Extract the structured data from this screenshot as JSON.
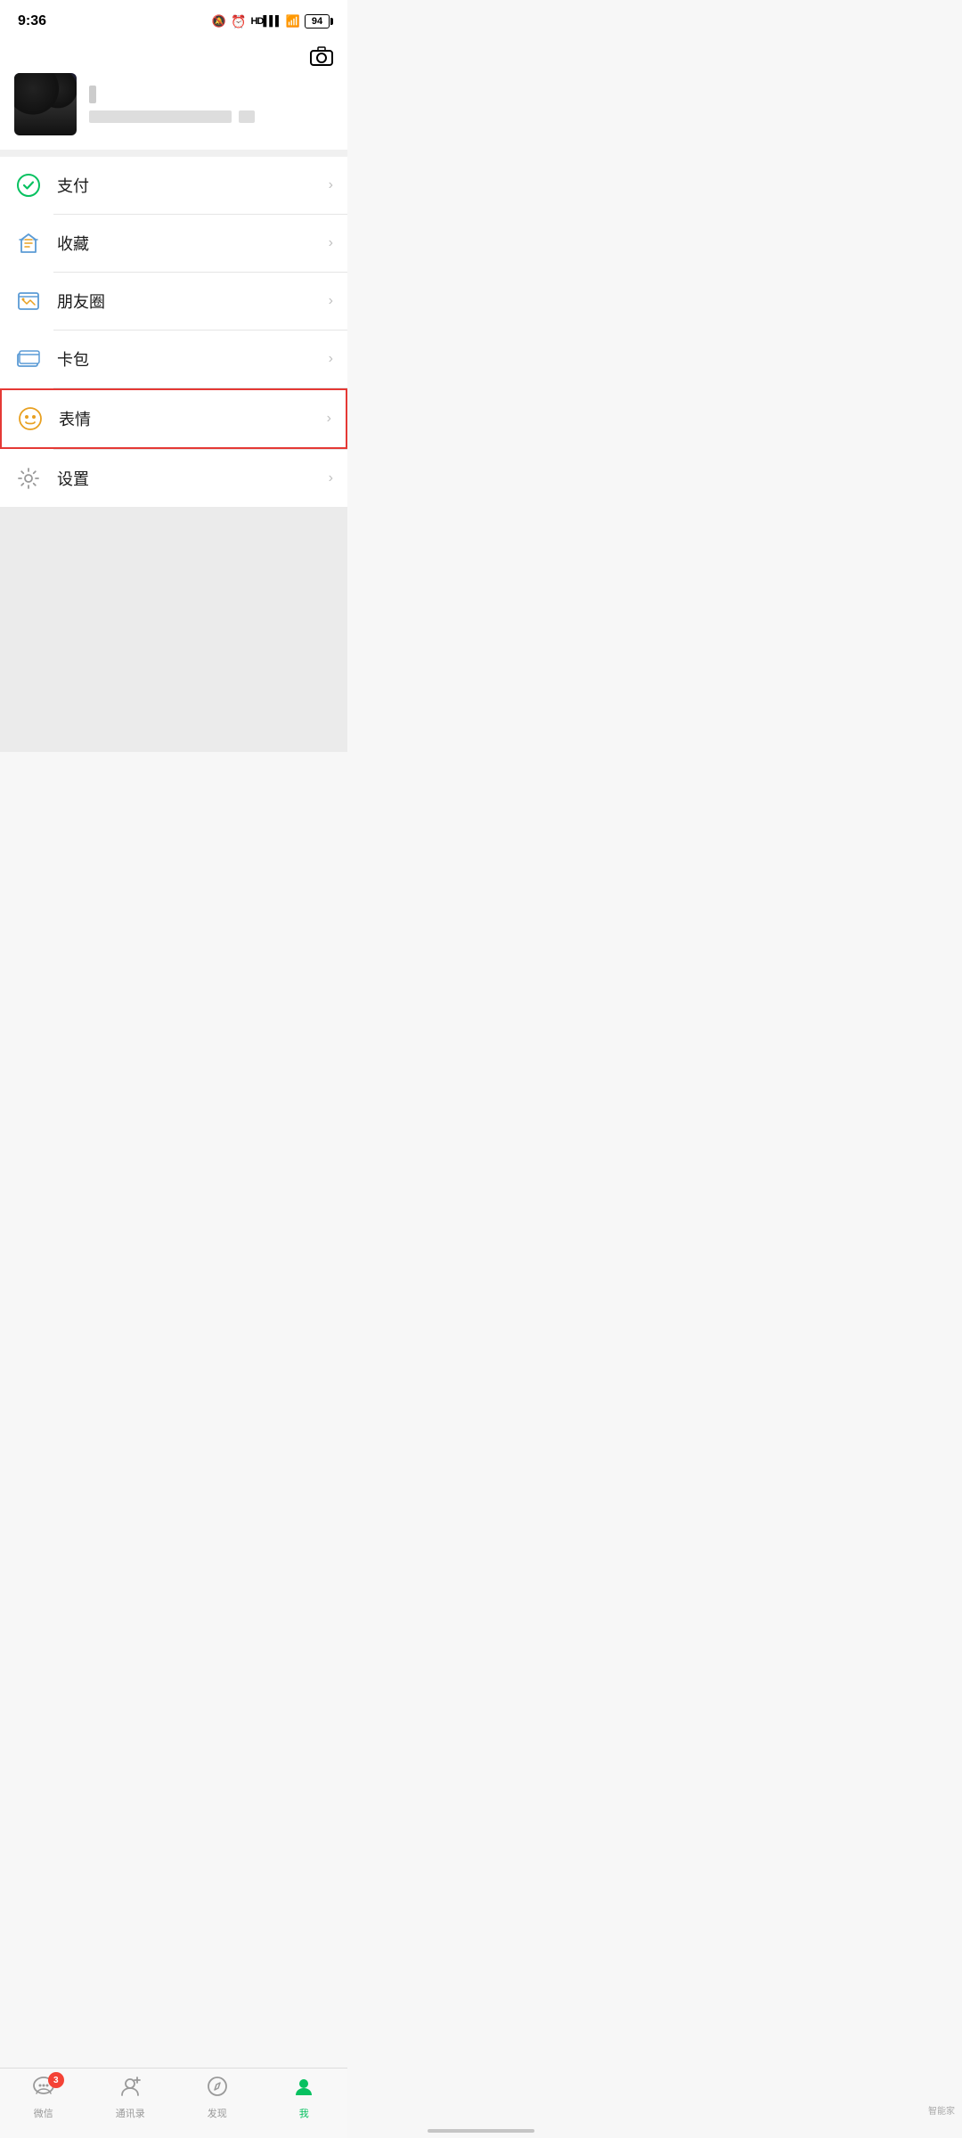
{
  "statusBar": {
    "time": "9:36",
    "battery": "94"
  },
  "header": {
    "cameraIcon": "📷"
  },
  "profile": {
    "nameBlurred": true,
    "idBlurred": true
  },
  "menuItems": [
    {
      "id": "payment",
      "label": "支付",
      "iconType": "payment",
      "highlighted": false
    },
    {
      "id": "favorites",
      "label": "收藏",
      "iconType": "favorites",
      "highlighted": false
    },
    {
      "id": "moments",
      "label": "朋友圈",
      "iconType": "moments",
      "highlighted": false
    },
    {
      "id": "cards",
      "label": "卡包",
      "iconType": "cards",
      "highlighted": false
    },
    {
      "id": "stickers",
      "label": "表情",
      "iconType": "stickers",
      "highlighted": true
    },
    {
      "id": "settings",
      "label": "设置",
      "iconType": "settings",
      "highlighted": false
    }
  ],
  "bottomNav": [
    {
      "id": "wechat",
      "label": "微信",
      "active": false,
      "badge": "3"
    },
    {
      "id": "contacts",
      "label": "通讯录",
      "active": false,
      "badge": null
    },
    {
      "id": "discover",
      "label": "发现",
      "active": false,
      "badge": null
    },
    {
      "id": "me",
      "label": "我",
      "active": true,
      "badge": null
    }
  ],
  "watermark": "智能家"
}
